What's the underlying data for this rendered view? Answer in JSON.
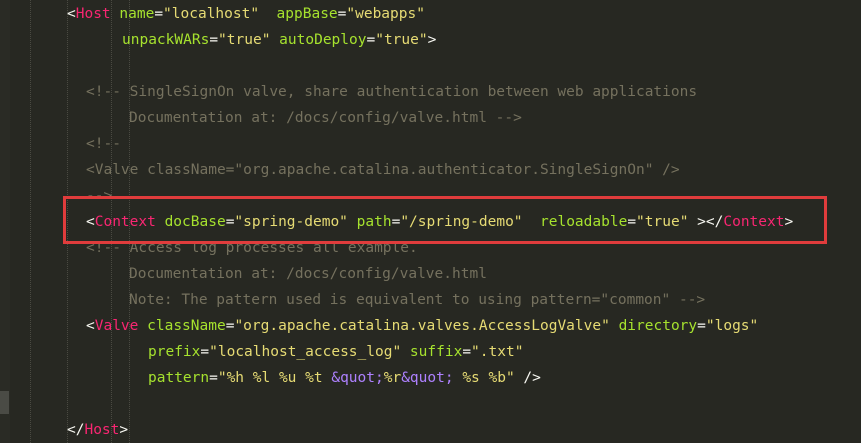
{
  "editor": {
    "lines": [
      {
        "parts": [
          {
            "t": "<",
            "c": "punc"
          },
          {
            "t": "Host",
            "c": "tag"
          },
          {
            "t": " ",
            "c": "punc"
          },
          {
            "t": "name",
            "c": "attr"
          },
          {
            "t": "=",
            "c": "punc"
          },
          {
            "t": "\"localhost\"",
            "c": "str"
          },
          {
            "t": "  ",
            "c": "punc"
          },
          {
            "t": "appBase",
            "c": "attr"
          },
          {
            "t": "=",
            "c": "punc"
          },
          {
            "t": "\"webapps\"",
            "c": "str"
          }
        ]
      },
      {
        "parts": [
          {
            "t": "unpackWARs",
            "c": "attr"
          },
          {
            "t": "=",
            "c": "punc"
          },
          {
            "t": "\"true\"",
            "c": "str"
          },
          {
            "t": " ",
            "c": "punc"
          },
          {
            "t": "autoDeploy",
            "c": "attr"
          },
          {
            "t": "=",
            "c": "punc"
          },
          {
            "t": "\"true\"",
            "c": "str"
          },
          {
            "t": ">",
            "c": "punc"
          }
        ]
      },
      {
        "parts": []
      },
      {
        "parts": [
          {
            "t": "<!-- SingleSignOn valve, share authentication between web applications",
            "c": "cmt"
          }
        ]
      },
      {
        "parts": [
          {
            "t": "Documentation at: /docs/config/valve.html -->",
            "c": "cmt"
          }
        ]
      },
      {
        "parts": [
          {
            "t": "<!--",
            "c": "cmt"
          }
        ]
      },
      {
        "parts": [
          {
            "t": "<Valve className=\"org.apache.catalina.authenticator.SingleSignOn\" />",
            "c": "cmt"
          }
        ]
      },
      {
        "parts": [
          {
            "t": "-->",
            "c": "cmt"
          }
        ]
      },
      {
        "parts": [
          {
            "t": "<",
            "c": "punc"
          },
          {
            "t": "Context",
            "c": "tag"
          },
          {
            "t": " ",
            "c": "punc"
          },
          {
            "t": "docBase",
            "c": "attr"
          },
          {
            "t": "=",
            "c": "punc"
          },
          {
            "t": "\"spring-demo\"",
            "c": "str"
          },
          {
            "t": " ",
            "c": "punc"
          },
          {
            "t": "path",
            "c": "attr"
          },
          {
            "t": "=",
            "c": "punc"
          },
          {
            "t": "\"/spring-demo\"",
            "c": "str"
          },
          {
            "t": "  ",
            "c": "punc"
          },
          {
            "t": "reloadable",
            "c": "attr"
          },
          {
            "t": "=",
            "c": "punc"
          },
          {
            "t": "\"true\"",
            "c": "str"
          },
          {
            "t": " ></",
            "c": "punc"
          },
          {
            "t": "Context",
            "c": "tag"
          },
          {
            "t": ">",
            "c": "punc"
          }
        ]
      },
      {
        "parts": [
          {
            "t": "<!-- Access log processes all example.",
            "c": "cmt"
          }
        ]
      },
      {
        "parts": [
          {
            "t": "Documentation at: /docs/config/valve.html",
            "c": "cmt"
          }
        ]
      },
      {
        "parts": [
          {
            "t": "Note: The pattern used is equivalent to using pattern=\"common\" -->",
            "c": "cmt"
          }
        ]
      },
      {
        "parts": [
          {
            "t": "<",
            "c": "punc"
          },
          {
            "t": "Valve",
            "c": "tag"
          },
          {
            "t": " ",
            "c": "punc"
          },
          {
            "t": "className",
            "c": "attr"
          },
          {
            "t": "=",
            "c": "punc"
          },
          {
            "t": "\"org.apache.catalina.valves.AccessLogValve\"",
            "c": "str"
          },
          {
            "t": " ",
            "c": "punc"
          },
          {
            "t": "directory",
            "c": "attr"
          },
          {
            "t": "=",
            "c": "punc"
          },
          {
            "t": "\"logs\"",
            "c": "str"
          }
        ]
      },
      {
        "parts": [
          {
            "t": "prefix",
            "c": "attr"
          },
          {
            "t": "=",
            "c": "punc"
          },
          {
            "t": "\"localhost_access_log\"",
            "c": "str"
          },
          {
            "t": " ",
            "c": "punc"
          },
          {
            "t": "suffix",
            "c": "attr"
          },
          {
            "t": "=",
            "c": "punc"
          },
          {
            "t": "\".txt\"",
            "c": "str"
          }
        ]
      },
      {
        "parts": [
          {
            "t": "pattern",
            "c": "attr"
          },
          {
            "t": "=",
            "c": "punc"
          },
          {
            "t": "\"%h %l %u %t ",
            "c": "str"
          },
          {
            "t": "&quot;",
            "c": "ent"
          },
          {
            "t": "%r",
            "c": "str"
          },
          {
            "t": "&quot;",
            "c": "ent"
          },
          {
            "t": " %s %b\"",
            "c": "str"
          },
          {
            "t": " />",
            "c": "punc"
          }
        ]
      },
      {
        "parts": []
      },
      {
        "parts": [
          {
            "t": "</",
            "c": "punc"
          },
          {
            "t": "Host",
            "c": "tag"
          },
          {
            "t": ">",
            "c": "punc"
          }
        ]
      }
    ]
  },
  "highlight": {
    "color": "#e03c3c",
    "target_line": 8
  }
}
